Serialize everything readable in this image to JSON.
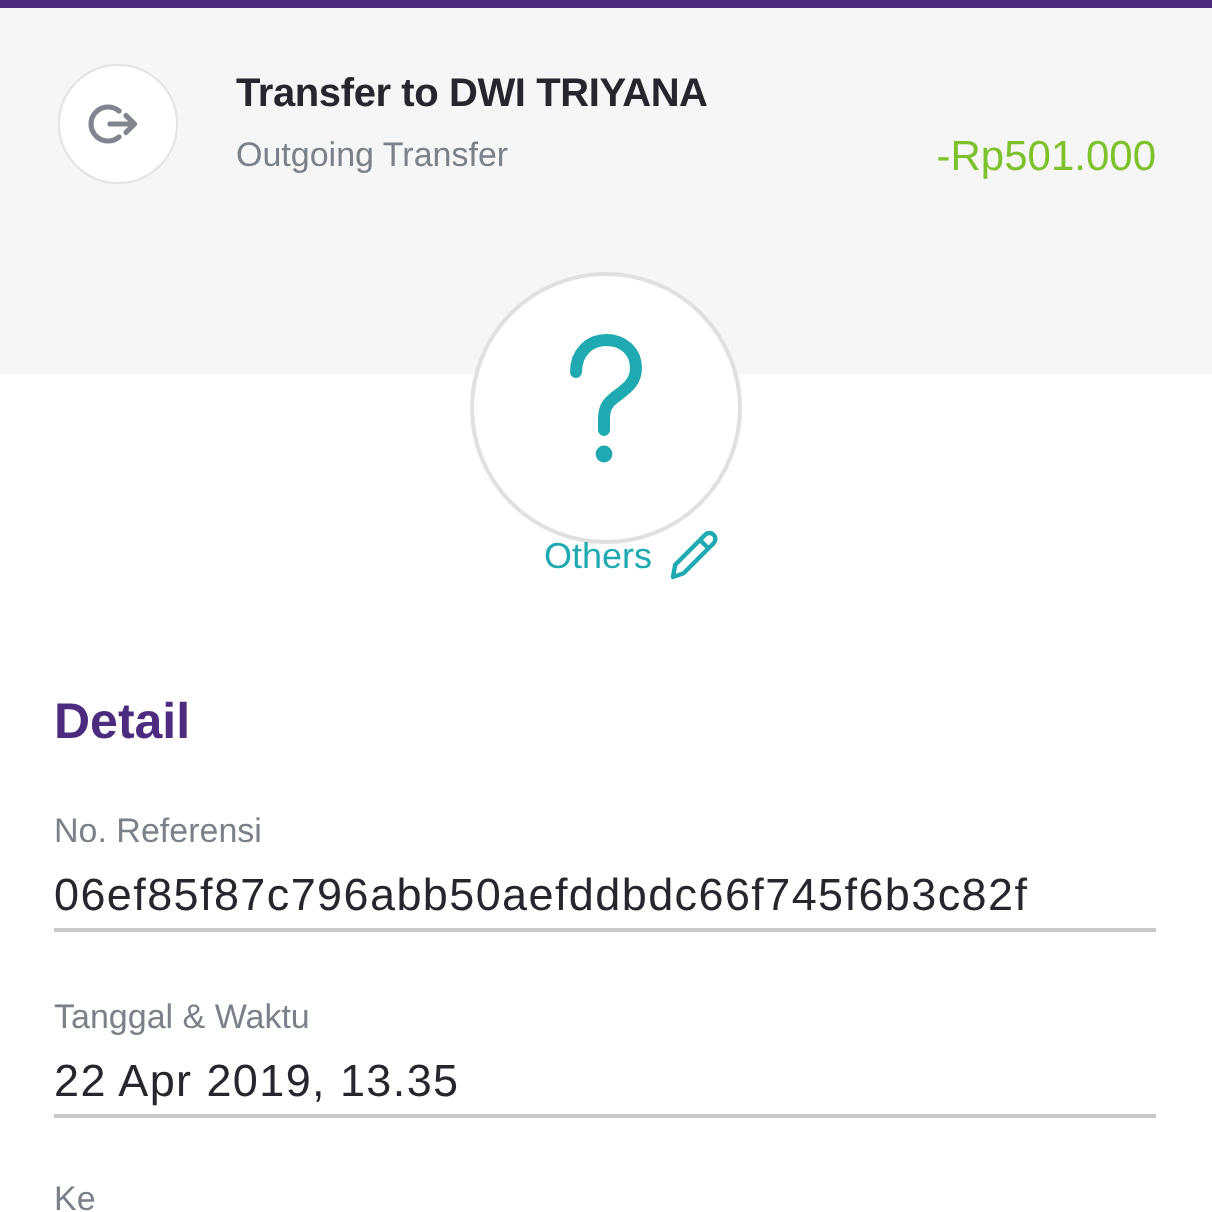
{
  "transaction": {
    "title": "Transfer to DWI TRIYANA",
    "subtitle": "Outgoing Transfer",
    "amount": "-Rp501.000"
  },
  "category": {
    "label": "Others"
  },
  "detail": {
    "heading": "Detail",
    "fields": [
      {
        "label": "No. Referensi",
        "value": "06ef85f87c796abb50aefddbdc66f745f6b3c82f"
      },
      {
        "label": "Tanggal & Waktu",
        "value": "22 Apr 2019, 13.35"
      },
      {
        "label": "Ke"
      }
    ]
  }
}
